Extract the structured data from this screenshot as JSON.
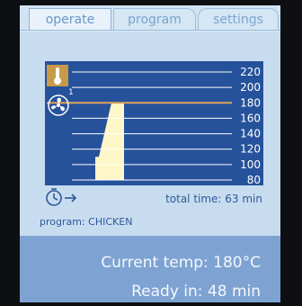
{
  "tabs": [
    {
      "label": "operate",
      "active": true
    },
    {
      "label": "program",
      "active": false
    },
    {
      "label": "settings",
      "active": false
    }
  ],
  "chart": {
    "y_ticks": [
      "220",
      "200",
      "180",
      "160",
      "140",
      "120",
      "100",
      "80"
    ],
    "step_number": "1",
    "icons": [
      "thermometer-icon",
      "fan-icon"
    ]
  },
  "chart_data": {
    "type": "area",
    "ylim": [
      80,
      220
    ],
    "target_line": 180,
    "series": [
      {
        "values": [
          90,
          110,
          180,
          180
        ]
      }
    ]
  },
  "info": {
    "timer_icon": "timer-icon",
    "total_time": "total time: 63 min",
    "program": "program: CHICKEN"
  },
  "status": {
    "current_temp": "Current temp: 180°C",
    "ready_in": "Ready in: 48 min"
  },
  "colors": {
    "chart_bg": "#26529b",
    "fill": "#fdf6c8",
    "target_line": "#e0a45a",
    "screen_bg": "#c8dcef",
    "status_bg": "#7ea3d2"
  }
}
